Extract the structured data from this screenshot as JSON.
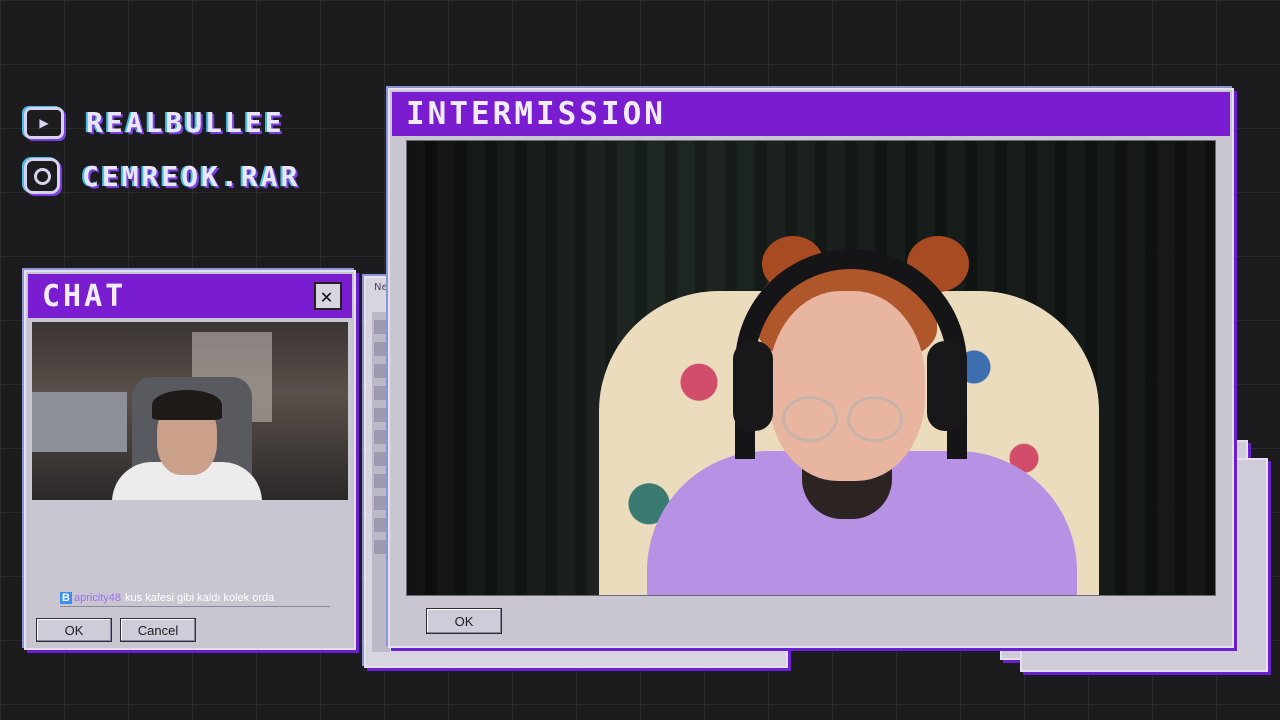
{
  "social": {
    "youtube": {
      "icon": "youtube-icon",
      "handle": "REALBULLEE"
    },
    "instagram": {
      "icon": "instagram-icon",
      "handle": "CEMREOK.RAR"
    }
  },
  "chat_window": {
    "title": "CHAT",
    "message": {
      "badge": "B",
      "username": "apricity48",
      "text": "kus kafesi gibi kaldı kolek orda"
    },
    "ok_label": "OK",
    "cancel_label": "Cancel"
  },
  "intermission_window": {
    "title": "INTERMISSION",
    "ok_label": "OK"
  },
  "paint_window": {
    "title_fragment": "Ne"
  },
  "colors": {
    "accent": "#7a1ccf",
    "window_bg": "#c9c6d2",
    "background": "#1c1c1e"
  }
}
